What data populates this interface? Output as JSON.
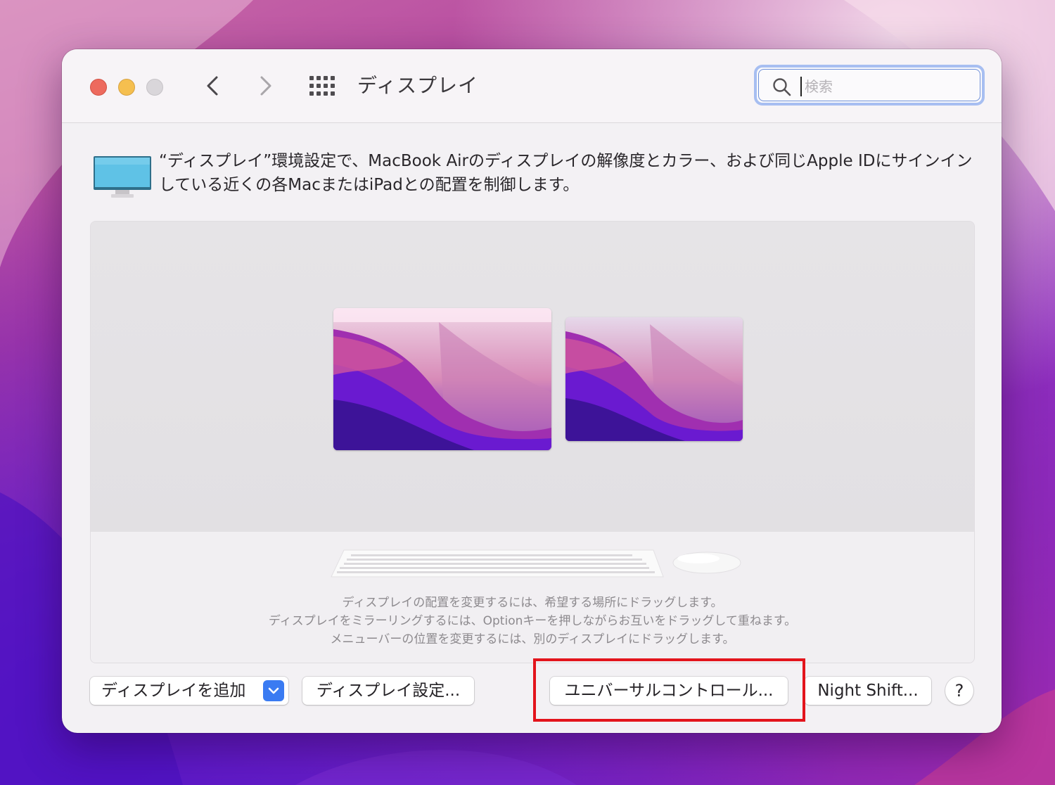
{
  "window": {
    "title": "ディスプレイ",
    "search_placeholder": "検索"
  },
  "description": "“ディスプレイ”環境設定で、MacBook Airのディスプレイの解像度とカラー、および同じApple IDにサインインしている近くの各MacまたはiPadとの配置を制御します。",
  "arrangement": {
    "displays": [
      "MacBook Air display (main, with menu bar)",
      "secondary display"
    ],
    "hints": [
      "ディスプレイの配置を変更するには、希望する場所にドラッグします。",
      "ディスプレイをミラーリングするには、Optionキーを押しながらお互いをドラッグして重ねます。",
      "メニューバーの位置を変更するには、別のディスプレイにドラッグします。"
    ]
  },
  "buttons": {
    "add_display": "ディスプレイを追加",
    "display_settings": "ディスプレイ設定...",
    "universal_control": "ユニバーサルコントロール...",
    "night_shift": "Night Shift...",
    "help": "?"
  },
  "colors": {
    "highlight": "#e3141c",
    "accent": "#3a7bf2"
  }
}
